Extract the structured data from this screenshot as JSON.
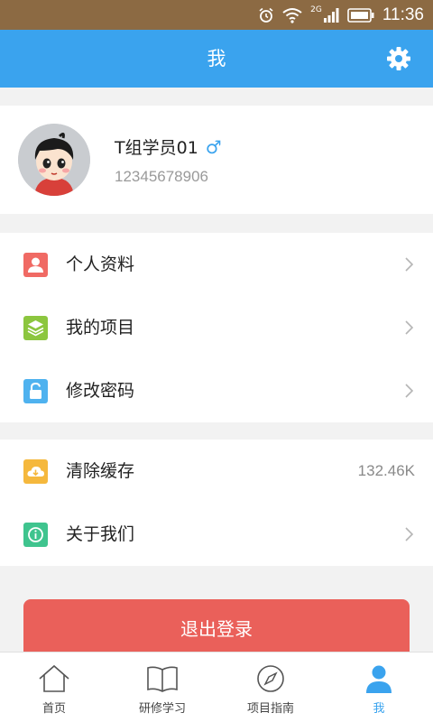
{
  "status_bar": {
    "time": "11:36",
    "network": "2G",
    "icons": [
      "alarm-icon",
      "wifi-icon",
      "signal-icon",
      "battery-icon"
    ]
  },
  "header": {
    "title": "我",
    "settings_icon": "gear-icon"
  },
  "profile": {
    "name": "T组学员01",
    "gender_symbol": "♂",
    "phone": "12345678906"
  },
  "menu_group_1": [
    {
      "label": "个人资料",
      "icon": "person-icon",
      "color": "#f06a64"
    },
    {
      "label": "我的项目",
      "icon": "layers-icon",
      "color": "#8cc63f"
    },
    {
      "label": "修改密码",
      "icon": "lock-icon",
      "color": "#4fb2ef"
    }
  ],
  "menu_group_2": [
    {
      "label": "清除缓存",
      "icon": "cloud-icon",
      "color": "#f5b83d",
      "value": "132.46K"
    },
    {
      "label": "关于我们",
      "icon": "info-icon",
      "color": "#3fc48e"
    }
  ],
  "logout_button": {
    "label": "退出登录",
    "color": "#ea605a"
  },
  "tabs": [
    {
      "label": "首页",
      "icon": "home-icon"
    },
    {
      "label": "研修学习",
      "icon": "book-icon"
    },
    {
      "label": "项目指南",
      "icon": "compass-icon"
    },
    {
      "label": "我",
      "icon": "user-icon",
      "active": true
    }
  ],
  "colors": {
    "primary": "#3aa3ee",
    "status_bar": "#8c6a43"
  }
}
